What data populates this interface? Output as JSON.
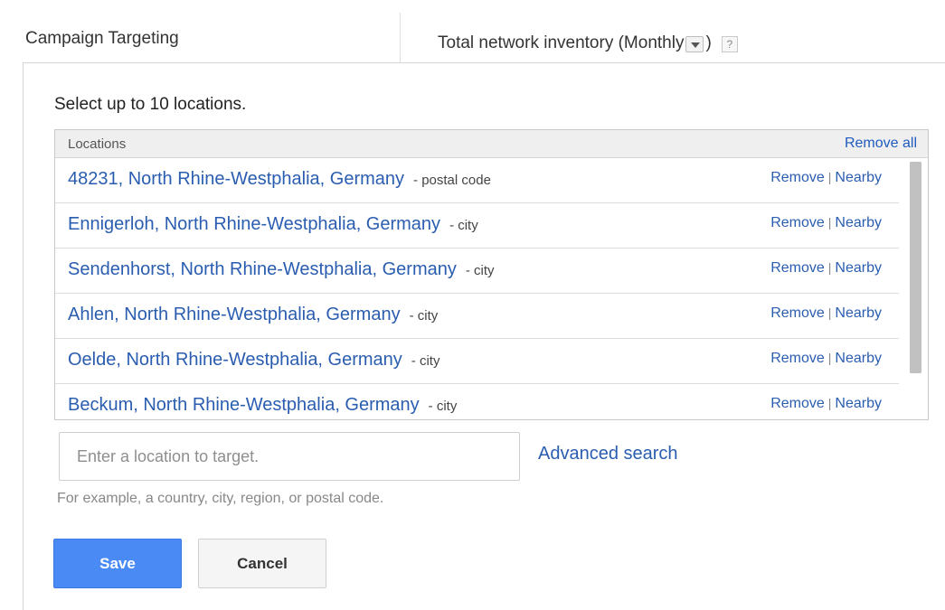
{
  "header": {
    "title": "Campaign Targeting",
    "inventory_label": "Total network inventory (Monthly",
    "close_paren": ")",
    "help_glyph": "?"
  },
  "panel": {
    "instruction": "Select up to 10 locations.",
    "table": {
      "column_header": "Locations",
      "remove_all": "Remove all",
      "remove_label": "Remove",
      "separator": "|",
      "nearby_label": "Nearby",
      "rows": [
        {
          "name": "48231, North Rhine-Westphalia, Germany",
          "type": "- postal code"
        },
        {
          "name": "Ennigerloh, North Rhine-Westphalia, Germany",
          "type": "- city"
        },
        {
          "name": "Sendenhorst, North Rhine-Westphalia, Germany",
          "type": "- city"
        },
        {
          "name": "Ahlen, North Rhine-Westphalia, Germany",
          "type": "- city"
        },
        {
          "name": "Oelde, North Rhine-Westphalia, Germany",
          "type": "- city"
        },
        {
          "name": "Beckum, North Rhine-Westphalia, Germany",
          "type": "- city"
        }
      ]
    },
    "search": {
      "placeholder": "Enter a location to target.",
      "value": "",
      "advanced_link": "Advanced search",
      "example": "For example, a country, city, region, or postal code."
    },
    "buttons": {
      "save": "Save",
      "cancel": "Cancel"
    }
  },
  "colors": {
    "link": "#2a5db0",
    "primary_button": "#4a8af4",
    "header_bg": "#efefef"
  },
  "icons": {
    "dropdown": "chevron-down-icon",
    "help": "help-icon"
  }
}
